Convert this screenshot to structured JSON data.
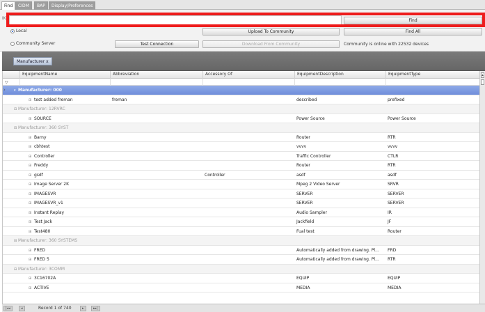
{
  "tabs": [
    "Find",
    "CIDM",
    "BAP",
    "Display/Preferences"
  ],
  "search": {
    "prefix": "IK",
    "value": ""
  },
  "buttons": {
    "find": "Find",
    "find_all": "Find All",
    "upload": "Upload To Community",
    "test_connection": "Test Connection",
    "download": "Download From Community"
  },
  "radios": {
    "local": "Local",
    "community": "Community Server"
  },
  "status": "Community is online with 22532 devices",
  "group_chip": "Manufacturer x",
  "columns": [
    "EquipmentName",
    "Abbreviation",
    "Accessory Of",
    "EquipmentDescription",
    "EquipmentType"
  ],
  "rows": [
    {
      "kind": "group",
      "selected": true,
      "label": "Manufacturer: 000"
    },
    {
      "kind": "item",
      "name": "test added freman",
      "abbr": "freman",
      "acc": "",
      "desc": "described",
      "type": "prefixed"
    },
    {
      "kind": "group",
      "label": "Manufacturer: 12RVRC"
    },
    {
      "kind": "item",
      "name": "SOURCE",
      "abbr": "",
      "acc": "",
      "desc": "Power Source",
      "type": "Power Source"
    },
    {
      "kind": "group",
      "label": "Manufacturer: 360 SYST"
    },
    {
      "kind": "item",
      "name": "Barny",
      "abbr": "",
      "acc": "",
      "desc": "Router",
      "type": "RTR"
    },
    {
      "kind": "item",
      "name": "cbhtest",
      "abbr": "",
      "acc": "",
      "desc": "vvvv",
      "type": "vvvv"
    },
    {
      "kind": "item",
      "name": "Controller",
      "abbr": "",
      "acc": "",
      "desc": "Traffic Controller",
      "type": "CTLR"
    },
    {
      "kind": "item",
      "name": "Freddy",
      "abbr": "",
      "acc": "",
      "desc": "Router",
      "type": "RTR"
    },
    {
      "kind": "item",
      "name": "gsdf",
      "abbr": "",
      "acc": "Controller",
      "desc": "asdf",
      "type": "asdf"
    },
    {
      "kind": "item",
      "name": "Image Server 2K",
      "abbr": "",
      "acc": "",
      "desc": "Mpeg 2 Video Server",
      "type": "SRVR"
    },
    {
      "kind": "item",
      "name": "IMAGESVR",
      "abbr": "",
      "acc": "",
      "desc": "SERVER",
      "type": "SERVER"
    },
    {
      "kind": "item",
      "name": "IMAGESVR_v1",
      "abbr": "",
      "acc": "",
      "desc": "SERVER",
      "type": "SERVER"
    },
    {
      "kind": "item",
      "name": "Instant Replay",
      "abbr": "",
      "acc": "",
      "desc": "Audio Sampler",
      "type": "IR"
    },
    {
      "kind": "item",
      "name": "Test Jack",
      "abbr": "",
      "acc": "",
      "desc": "Jackfield",
      "type": "JF"
    },
    {
      "kind": "item",
      "name": "Test480",
      "abbr": "",
      "acc": "",
      "desc": "Fual test",
      "type": "Router"
    },
    {
      "kind": "group",
      "label": "Manufacturer: 360 SYSTEMS"
    },
    {
      "kind": "item",
      "name": "FRED",
      "abbr": "",
      "acc": "",
      "desc": "Automatically added from drawing. Pl...",
      "type": "FRD"
    },
    {
      "kind": "item",
      "name": "FRED 5",
      "abbr": "",
      "acc": "",
      "desc": "Automatically added from drawing. Pl...",
      "type": "RTR"
    },
    {
      "kind": "group",
      "label": "Manufacturer: 3COMM"
    },
    {
      "kind": "item",
      "name": "3C16702A",
      "abbr": "",
      "acc": "",
      "desc": "EQUIP",
      "type": "EQUIP"
    },
    {
      "kind": "item",
      "name": "ACTIVE",
      "abbr": "",
      "acc": "",
      "desc": "MEDIA",
      "type": "MEDIA"
    }
  ],
  "pager": {
    "record_text": "Record 1 of 740"
  },
  "colors": {
    "highlight": "#ee1c1c",
    "selected_group": "#7a97df"
  }
}
